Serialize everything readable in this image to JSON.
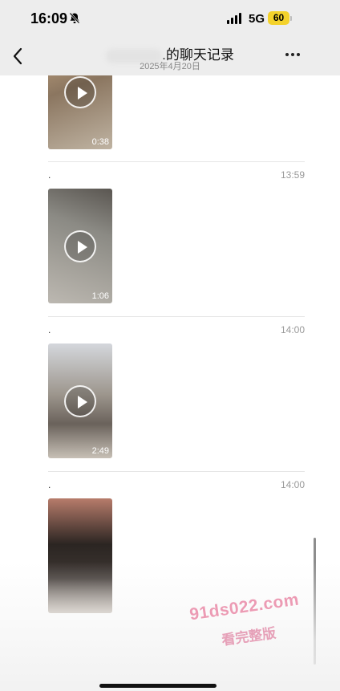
{
  "status_bar": {
    "time": "16:09",
    "network": "5G",
    "battery": "60"
  },
  "nav": {
    "title": ".的聊天记录",
    "subtitle": "2025年4月20日"
  },
  "messages": [
    {
      "sender": ".",
      "time": "",
      "duration": "0:38"
    },
    {
      "sender": ".",
      "time": "13:59",
      "duration": "1:06"
    },
    {
      "sender": ".",
      "time": "14:00",
      "duration": "2:49"
    },
    {
      "sender": ".",
      "time": "14:00",
      "duration": ""
    }
  ],
  "watermark": {
    "line1": "91ds022.com",
    "line2": "看完整版"
  }
}
